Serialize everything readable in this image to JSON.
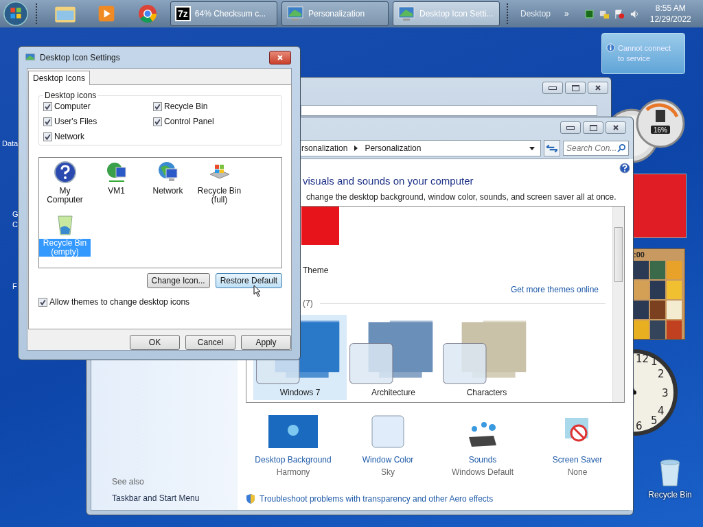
{
  "taskbar": {
    "pinned": [
      {
        "kind": "explorer"
      },
      {
        "kind": "media"
      },
      {
        "kind": "browser"
      }
    ],
    "tasks": [
      {
        "kind": "archiver",
        "icon_text": "7z",
        "label": "64% Checksum c...",
        "selected": false
      },
      {
        "kind": "monitor",
        "label": "Personalization",
        "selected": false
      },
      {
        "kind": "monitor",
        "label": "Desktop Icon Setti...",
        "selected": true
      }
    ],
    "toolbar_label": "Desktop",
    "toolbar_more": "»",
    "time": "8:55 AM",
    "date": "12/29/2022"
  },
  "desktop": {
    "left_labels": [
      "Data",
      "G",
      "C",
      "F"
    ],
    "notification": "Cannot connect to service",
    "cpu_reading": "16%",
    "puzzle_timer": ":00",
    "clock_numbers": [
      "12",
      "1",
      "2",
      "3",
      "4",
      "6",
      "5"
    ],
    "recycle_bin": "Recycle Bin"
  },
  "dialog": {
    "title": "Desktop Icon Settings",
    "tabs": [
      {
        "label": "Desktop Icons",
        "selected": true
      }
    ],
    "group": "Desktop icons",
    "checkboxes": [
      {
        "label": "Computer",
        "checked": true
      },
      {
        "label": "Recycle Bin",
        "checked": true
      },
      {
        "label": "User's Files",
        "checked": true
      },
      {
        "label": "Control Panel",
        "checked": true
      },
      {
        "label": "Network",
        "checked": true
      }
    ],
    "icons": [
      {
        "kind": "help",
        "label": "My Computer",
        "selected": false
      },
      {
        "kind": "network-pc",
        "label": "VM1",
        "selected": false
      },
      {
        "kind": "globe-pc",
        "label": "Network",
        "selected": false
      },
      {
        "kind": "bin-full",
        "label": "Recycle Bin (full)",
        "selected": false
      },
      {
        "kind": "bin-empty",
        "label": "Recycle Bin (empty)",
        "selected": true
      }
    ],
    "change_button": "Change Icon...",
    "restore_button": "Restore Default",
    "allow_themes": {
      "label": "Allow themes to change desktop icons",
      "checked": true
    },
    "buttons": [
      "OK",
      "Cancel",
      "Apply"
    ]
  },
  "personalization": {
    "breadcrumb": [
      "rsonalization",
      "Personalization"
    ],
    "search": {
      "placeholder": "Search Con..."
    },
    "heading": "visuals and sounds on your computer",
    "subtitle": "change the desktop background, window color, sounds, and screen saver all at once.",
    "theme_label": "Theme",
    "more_themes_link": "Get more themes online",
    "group_count": "(7)",
    "themes": [
      {
        "label": "Windows 7",
        "selected": true
      },
      {
        "label": "Architecture",
        "selected": false
      },
      {
        "label": "Characters",
        "selected": false
      }
    ],
    "settings": [
      {
        "kind": "background",
        "title": "Desktop Background",
        "value": "Harmony"
      },
      {
        "kind": "color",
        "title": "Window Color",
        "value": "Sky"
      },
      {
        "kind": "sounds",
        "title": "Sounds",
        "value": "Windows Default"
      },
      {
        "kind": "saver",
        "title": "Screen Saver",
        "value": "None"
      }
    ],
    "troubleshoot_link": "Troubleshoot problems with transparency and other Aero effects",
    "see_also": "See also",
    "sidebar_links": [
      "Taskbar and Start Menu"
    ]
  }
}
